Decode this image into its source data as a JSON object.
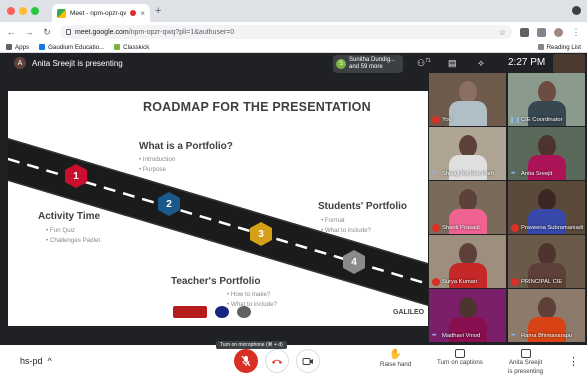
{
  "browser": {
    "tab_title": "Meet - npm-opzr-qwq",
    "url_host": "meet.google.com",
    "url_path": "/npm-opzr-qwq?pli=1&authuser=0",
    "bookmarks": [
      "Apps",
      "Gaudium Educatio...",
      "Classkick"
    ],
    "reading_list": "Reading List",
    "colors": {
      "close": "#ff5f57",
      "min": "#febc2e",
      "max": "#28c840"
    }
  },
  "meet": {
    "presenter_initial": "A",
    "presenting_label": "Anita Sreejit is presenting",
    "participants_chip": {
      "initial": "S",
      "line1": "Sunitha Dundig...",
      "line2": "and 59 more"
    },
    "people_count": "71",
    "time": "2:27 PM"
  },
  "slide": {
    "title": "ROADMAP FOR THE PRESENTATION",
    "sections": [
      {
        "number": "1",
        "heading": "What is a Portfolio?",
        "bullets": [
          "Introduction",
          "Purpose"
        ],
        "color": "#c8102e"
      },
      {
        "number": "2",
        "heading": "Activity Time",
        "bullets": [
          "Fun Quiz",
          "Challenges Padlet"
        ],
        "color": "#1a5a8a"
      },
      {
        "number": "3",
        "heading": "Students' Portfolio",
        "bullets": [
          "Format",
          "What to include?"
        ],
        "color": "#d4a017"
      },
      {
        "number": "4",
        "heading": "Teacher's Portfolio",
        "bullets": [
          "How to make?",
          "What to include?"
        ],
        "color": "#8a8a8a"
      }
    ],
    "footer_brand": "GALILEO"
  },
  "participants": [
    {
      "name": "You",
      "status": "muted"
    },
    {
      "name": "CIE Coordinator",
      "status": "speaking"
    },
    {
      "name": "Shivaji Ra Ren Path",
      "status": "active"
    },
    {
      "name": "Anita Sreejit",
      "status": "active"
    },
    {
      "name": "Shanti Prasadi",
      "status": "muted"
    },
    {
      "name": "Praveena Subramaniadi",
      "status": "muted"
    },
    {
      "name": "Surya Kumari",
      "status": "muted"
    },
    {
      "name": "PRINCIPAL CIE",
      "status": "muted"
    },
    {
      "name": "Madhavi Vinod",
      "status": "active"
    },
    {
      "name": "Rama Bhimavarapu",
      "status": "active"
    }
  ],
  "controls": {
    "meeting_code": "hs-pd",
    "mic_tooltip": "Turn on microphone (⌘ + d)",
    "raise_hand": "Raise hand",
    "captions": "Turn on captions",
    "present_line1": "Anita Sreejit",
    "present_line2": "is presenting",
    "mic_color": "#d93025",
    "end_color": "#ea4335"
  }
}
